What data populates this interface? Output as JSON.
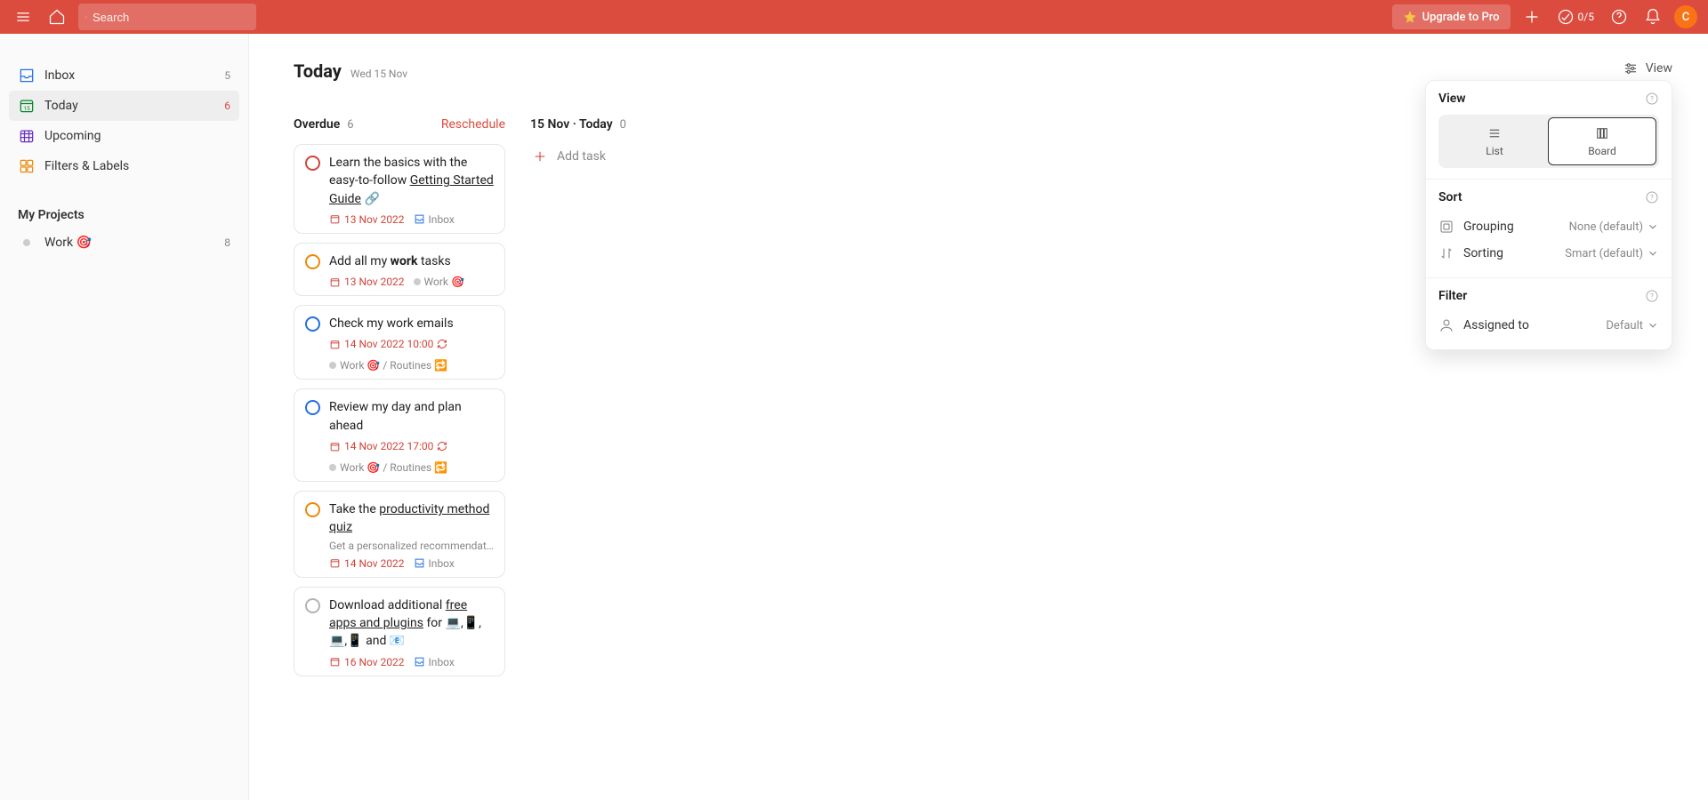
{
  "topbar": {
    "search_placeholder": "Search",
    "upgrade_label": "Upgrade to Pro",
    "productivity_count": "0/5",
    "avatar_letter": "C"
  },
  "sidebar": {
    "items": [
      {
        "label": "Inbox",
        "count": "5"
      },
      {
        "label": "Today",
        "count": "6"
      },
      {
        "label": "Upcoming",
        "count": ""
      },
      {
        "label": "Filters & Labels",
        "count": ""
      }
    ],
    "projects_title": "My Projects",
    "projects": [
      {
        "label": "Work",
        "emoji": "🎯",
        "count": "8"
      }
    ]
  },
  "page": {
    "title": "Today",
    "date": "Wed 15 Nov",
    "view_label": "View"
  },
  "columns": {
    "overdue": {
      "title": "Overdue",
      "count": "6",
      "reschedule": "Reschedule"
    },
    "today": {
      "title_date": "15 Nov",
      "title_today": "Today",
      "count": "0",
      "add_task": "Add task"
    }
  },
  "tasks": [
    {
      "priority": "p1",
      "title_pre": "Learn the basics with the easy-to-follow ",
      "title_link": "Getting Started Guide",
      "title_post": " 🔗",
      "date": "13 Nov 2022",
      "project": "Inbox",
      "project_type": "inbox"
    },
    {
      "priority": "p2",
      "title_pre": "Add all my ",
      "title_bold": "work",
      "title_post": " tasks",
      "date": "13 Nov 2022",
      "project": "Work 🎯",
      "project_type": "work"
    },
    {
      "priority": "p3",
      "title_pre": "Check my work emails",
      "date": "14 Nov 2022 10:00",
      "recurring": true,
      "project": "Work 🎯 / Routines 🔁",
      "project_type": "work"
    },
    {
      "priority": "p3",
      "title_pre": "Review my day and plan ahead",
      "date": "14 Nov 2022 17:00",
      "recurring": true,
      "project": "Work 🎯 / Routines 🔁",
      "project_type": "work"
    },
    {
      "priority": "p2",
      "title_pre": "Take the ",
      "title_link": "productivity method quiz",
      "description": "Get a personalized recommendation f…",
      "date": "14 Nov 2022",
      "project": "Inbox",
      "project_type": "inbox"
    },
    {
      "priority": "p4",
      "title_pre": "Download additional ",
      "title_link": "free apps and plugins",
      "title_post": " for 💻,📱,💻,📱 and 📧",
      "date": "16 Nov 2022",
      "project": "Inbox",
      "project_type": "inbox"
    }
  ],
  "view_panel": {
    "view_title": "View",
    "list_label": "List",
    "board_label": "Board",
    "sort_title": "Sort",
    "grouping_label": "Grouping",
    "grouping_value": "None (default)",
    "sorting_label": "Sorting",
    "sorting_value": "Smart (default)",
    "filter_title": "Filter",
    "assigned_label": "Assigned to",
    "assigned_value": "Default"
  }
}
